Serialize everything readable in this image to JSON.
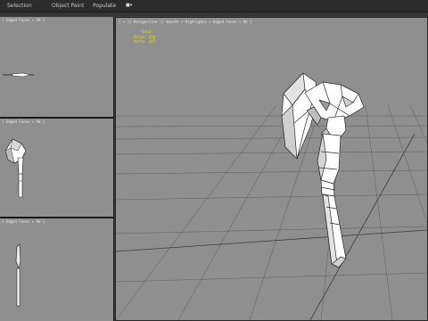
{
  "menu": {
    "items": [
      "Selection",
      "Object Paint",
      "Populate"
    ],
    "tool_glyph": "■▾"
  },
  "viewports": {
    "top_left_label": "[ Edged Faces + 90 ]",
    "mid_left_label": "[ Edged Faces + 90 ]",
    "bottom_left_label": "[ Edged Faces + 90 ]",
    "main_label": "[ + ][ Perspective ][ Smooth + Highlights + Edged Faces + 90 ]"
  },
  "stats": {
    "header": "Total",
    "polys_label": "Polys:",
    "polys_value": "650",
    "verts_label": "Verts:",
    "verts_value": "327"
  },
  "colors": {
    "viewport_bg": "#8f8f8f",
    "grid_line": "#5a5a5a",
    "stats_text": "#e6e600",
    "mesh_fill": "#ffffff",
    "mesh_edge": "#2a2a2a"
  }
}
